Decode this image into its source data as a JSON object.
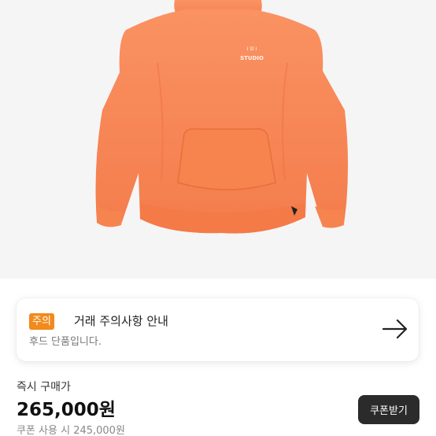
{
  "product": {
    "image_alt": "orange hoodie",
    "print_text_top": "Ꭵ ᗯ Ꭵ",
    "print_text_bottom": "STUDIO",
    "colors": {
      "hoodie": "#f98a5a",
      "hoodie_shade": "#f47a4a",
      "background": "#f5f5f6"
    }
  },
  "notice": {
    "badge": "주의",
    "title": "거래 주의사항 안내",
    "subtitle": "후드 단품입니다.",
    "arrow_icon": "arrow-right-icon",
    "badge_color": "#f28a1c"
  },
  "price": {
    "label": "즉시 구매가",
    "value": "265,000원",
    "coupon_button": "쿠폰받기",
    "coupon_note": "쿠폰 사용 시 245,000원"
  }
}
